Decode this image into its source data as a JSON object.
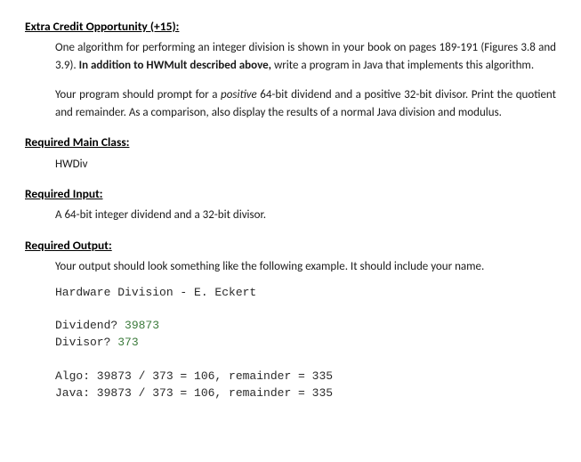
{
  "extraCredit": {
    "heading": "Extra Credit Opportunity (+15):",
    "para1_a": "One algorithm for performing an integer division is shown in your book on pages 189-191 (Figures 3.8 and 3.9). ",
    "para1_bold": "In addition to HWMult described above, ",
    "para1_b": "write a program in Java that implements this algorithm.",
    "para2_a": "Your program should prompt for a ",
    "para2_italic": "positive",
    "para2_b": " 64-bit dividend and a positive 32-bit divisor. Print the quotient and remainder. As a comparison, also display the results of a normal Java division and modulus."
  },
  "mainClass": {
    "heading": "Required Main Class:",
    "value": "HWDiv"
  },
  "input": {
    "heading": "Required Input:",
    "value": "A 64-bit integer dividend and a 32-bit divisor."
  },
  "output": {
    "heading": "Required Output:",
    "intro": "Your output should look something like the following example. It should include your name.",
    "line_title": "Hardware Division - E. Eckert",
    "line_dividend_label": "Dividend? ",
    "line_dividend_value": "39873",
    "line_divisor_label": "Divisor? ",
    "line_divisor_value": "373",
    "line_algo": "Algo: 39873 / 373 = 106, remainder = 335",
    "line_java": "Java: 39873 / 373 = 106, remainder = 335"
  }
}
